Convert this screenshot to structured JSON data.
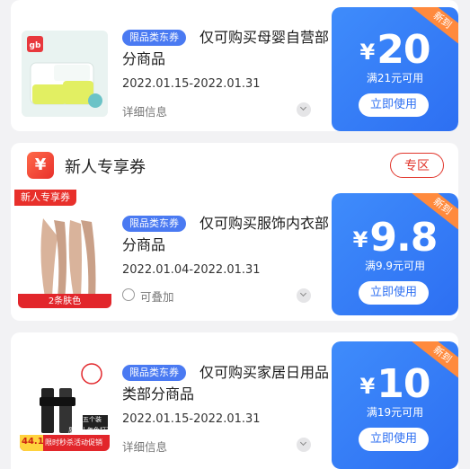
{
  "coupons": [
    {
      "tag": "限品类东券",
      "title": "仅可购买母婴自营部分商品",
      "date": "2022.01.15-2022.01.31",
      "footer": "详细信息",
      "ribbon": "新到",
      "currency": "¥",
      "amount": "20",
      "condition": "满21元可用",
      "button": "立即使用",
      "image": {
        "brand": "gb"
      }
    },
    {
      "corner_label": "新人专享券",
      "tag": "限品类东券",
      "title": "仅可购买服饰内衣部分商品",
      "date": "2022.01.04-2022.01.31",
      "footer": "可叠加",
      "ribbon": "新到",
      "currency": "¥",
      "amount": "9.8",
      "condition": "满9.9元可用",
      "button": "立即使用",
      "image": {
        "caption": "2条肤色"
      }
    },
    {
      "tag": "限品类东券",
      "title": "仅可购买家居日用品类部分商品",
      "date": "2022.01.15-2022.01.31",
      "footer": "详细信息",
      "ribbon": "新到",
      "currency": "¥",
      "amount": "10",
      "condition": "满19元可用",
      "button": "立即使用",
      "image": {
        "price": "44.1",
        "promo": "限时秒杀活动促销",
        "badge": "五个装",
        "sub1": "质保十年",
        "sub2": "免打孔"
      }
    }
  ],
  "section": {
    "icon": "¥",
    "title": "新人专享券",
    "button": "专区"
  },
  "colors": {
    "accent_blue": "#2d6ff2",
    "accent_red": "#e1352b",
    "ribbon_orange": "#ff8a3d"
  }
}
